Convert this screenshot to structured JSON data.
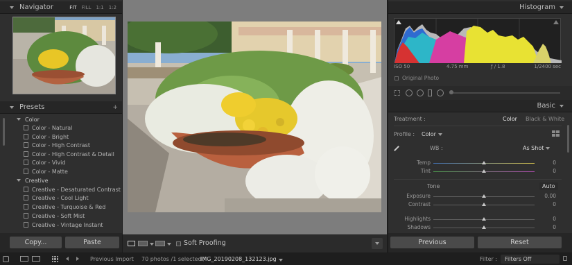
{
  "colors": {
    "accent": "#e0e0e0",
    "panel": "#303030",
    "center": "#7e7e7e"
  },
  "navigator": {
    "title": "Navigator",
    "zoom_options": [
      "FIT",
      "FILL",
      "1:1",
      "1:2"
    ]
  },
  "presets": {
    "title": "Presets",
    "add_icon": "plus-icon",
    "groups": [
      {
        "name": "Color",
        "items": [
          "Color - Natural",
          "Color - Bright",
          "Color - High Contrast",
          "Color - High Contrast & Detail",
          "Color - Vivid",
          "Color - Matte"
        ]
      },
      {
        "name": "Creative",
        "items": [
          "Creative - Desaturated Contrast",
          "Creative - Cool Light",
          "Creative - Turquoise & Red",
          "Creative - Soft Mist",
          "Creative - Vintage Instant"
        ]
      }
    ]
  },
  "left_buttons": {
    "copy": "Copy...",
    "paste": "Paste"
  },
  "center_toolbar": {
    "soft_proofing": "Soft Proofing"
  },
  "histogram": {
    "title": "Histogram",
    "iso": "ISO 50",
    "focal": "4.75 mm",
    "aperture": "ƒ / 1.8",
    "shutter": "1/2400 sec",
    "original_photo": "Original Photo"
  },
  "basic": {
    "title": "Basic",
    "treatment_label": "Treatment :",
    "treatment_color": "Color",
    "treatment_bw": "Black & White",
    "profile_label": "Profile :",
    "profile_value": "Color",
    "wb_label": "WB :",
    "wb_value": "As Shot",
    "tone_label": "Tone",
    "auto": "Auto",
    "sliders": [
      {
        "label": "Temp",
        "value": "0",
        "level": 0.5
      },
      {
        "label": "Tint",
        "value": "0",
        "level": 0.5
      },
      {
        "label": "Exposure",
        "value": "0.00",
        "level": 0.5
      },
      {
        "label": "Contrast",
        "value": "0",
        "level": 0.5
      },
      {
        "label": "Highlights",
        "value": "0",
        "level": 0.5
      },
      {
        "label": "Shadows",
        "value": "0",
        "level": 0.5
      }
    ]
  },
  "right_buttons": {
    "previous": "Previous",
    "reset": "Reset"
  },
  "filmstrip": {
    "previous_import": "Previous Import",
    "count": "70 photos /1 selected /",
    "filename": "IMG_20190208_132123.jpg",
    "filter_label": "Filter :",
    "filter_value": "Filters Off"
  }
}
